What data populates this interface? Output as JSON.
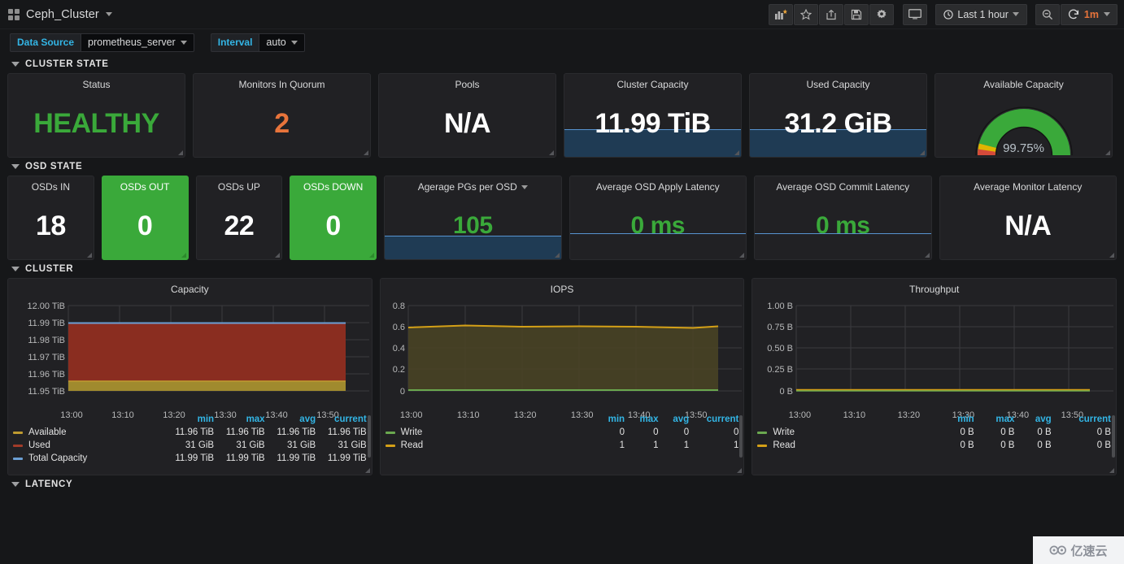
{
  "nav": {
    "dashboard_title": "Ceph_Cluster",
    "icons": [
      "dashboard-grid-icon",
      "add-panel-icon",
      "star-icon",
      "share-icon",
      "save-icon",
      "settings-icon",
      "tv-mode-icon",
      "zoom-out-icon",
      "refresh-icon"
    ],
    "time_range": "Last 1 hour",
    "refresh_interval": "1m",
    "refresh_color": "#e8743b"
  },
  "submenu": {
    "datasource_label": "Data Source",
    "datasource_value": "prometheus_server",
    "interval_label": "Interval",
    "interval_value": "auto"
  },
  "rows": {
    "cluster_state": "CLUSTER STATE",
    "osd_state": "OSD STATE",
    "cluster": "CLUSTER",
    "latency": "LATENCY"
  },
  "cluster_state": [
    {
      "title": "Status",
      "value": "HEALTHY",
      "color": "#3aa93a",
      "style": "plain"
    },
    {
      "title": "Monitors In Quorum",
      "value": "2",
      "color": "#e8743b",
      "style": "plain"
    },
    {
      "title": "Pools",
      "value": "N/A",
      "color": "#ffffff",
      "style": "plain"
    },
    {
      "title": "Cluster Capacity",
      "value": "11.99 TiB",
      "color": "#ffffff",
      "style": "sparkline"
    },
    {
      "title": "Used Capacity",
      "value": "31.2 GiB",
      "color": "#ffffff",
      "style": "sparkline"
    },
    {
      "title": "Available Capacity",
      "value": "99.75%",
      "color": "#3aa93a",
      "style": "gauge"
    }
  ],
  "osd_state": [
    {
      "title": "OSDs IN",
      "value": "18",
      "color": "#ffffff",
      "style": "plain",
      "bg": "none"
    },
    {
      "title": "OSDs OUT",
      "value": "0",
      "color": "#ffffff",
      "style": "plain",
      "bg": "green"
    },
    {
      "title": "OSDs UP",
      "value": "22",
      "color": "#ffffff",
      "style": "plain",
      "bg": "none"
    },
    {
      "title": "OSDs DOWN",
      "value": "0",
      "color": "#ffffff",
      "style": "plain",
      "bg": "green"
    },
    {
      "title": "Agerage PGs per OSD",
      "value": "105",
      "color": "#3aa93a",
      "style": "sparkline-dd",
      "bg": "none"
    },
    {
      "title": "Average OSD Apply Latency",
      "value": "0 ms",
      "color": "#3aa93a",
      "style": "line",
      "bg": "none"
    },
    {
      "title": "Average OSD Commit Latency",
      "value": "0 ms",
      "color": "#3aa93a",
      "style": "line",
      "bg": "none"
    },
    {
      "title": "Average Monitor Latency",
      "value": "N/A",
      "color": "#ffffff",
      "style": "plain",
      "bg": "none"
    }
  ],
  "chart_data": [
    {
      "type": "area",
      "title": "Capacity",
      "xlabel": "",
      "ylabel": "",
      "x": [
        "13:00",
        "13:10",
        "13:20",
        "13:30",
        "13:40",
        "13:50"
      ],
      "yticks": [
        "11.95 TiB",
        "11.96 TiB",
        "11.97 TiB",
        "11.98 TiB",
        "11.99 TiB",
        "12.00 TiB"
      ],
      "ylim": [
        11.95,
        12.0
      ],
      "grid": true,
      "legend_position": "bottom-table",
      "legend_columns": [
        "min",
        "max",
        "avg",
        "current"
      ],
      "series": [
        {
          "name": "Available",
          "color": "#bf9b30",
          "values": [
            11.96,
            11.96,
            11.96,
            11.96,
            11.96,
            11.96
          ],
          "min": "11.96 TiB",
          "max": "11.96 TiB",
          "avg": "11.96 TiB",
          "current": "11.96 TiB"
        },
        {
          "name": "Used",
          "color": "#a23b29",
          "values": [
            0.031,
            0.031,
            0.031,
            0.031,
            0.031,
            0.031
          ],
          "min": "31 GiB",
          "max": "31 GiB",
          "avg": "31 GiB",
          "current": "31 GiB"
        },
        {
          "name": "Total Capacity",
          "color": "#6b9fd4",
          "values": [
            11.99,
            11.99,
            11.99,
            11.99,
            11.99,
            11.99
          ],
          "min": "11.99 TiB",
          "max": "11.99 TiB",
          "avg": "11.99 TiB",
          "current": "11.99 TiB"
        }
      ]
    },
    {
      "type": "area",
      "title": "IOPS",
      "xlabel": "",
      "ylabel": "",
      "x": [
        "13:00",
        "13:10",
        "13:20",
        "13:30",
        "13:40",
        "13:50"
      ],
      "yticks": [
        "0",
        "0.2",
        "0.4",
        "0.6",
        "0.8"
      ],
      "ylim": [
        0,
        0.8
      ],
      "grid": true,
      "legend_position": "bottom-table",
      "legend_columns": [
        "min",
        "max",
        "avg",
        "current"
      ],
      "series": [
        {
          "name": "Write",
          "color": "#6aa84f",
          "values": [
            0,
            0,
            0,
            0,
            0,
            0
          ],
          "min": "0",
          "max": "0",
          "avg": "0",
          "current": "0"
        },
        {
          "name": "Read",
          "color": "#d4a017",
          "values": [
            0.6,
            0.62,
            0.61,
            0.61,
            0.6,
            0.61
          ],
          "min": "1",
          "max": "1",
          "avg": "1",
          "current": "1"
        }
      ]
    },
    {
      "type": "area",
      "title": "Throughput",
      "xlabel": "",
      "ylabel": "",
      "x": [
        "13:00",
        "13:10",
        "13:20",
        "13:30",
        "13:40",
        "13:50"
      ],
      "yticks": [
        "0 B",
        "0.25 B",
        "0.50 B",
        "0.75 B",
        "1.00 B"
      ],
      "ylim": [
        0,
        1
      ],
      "grid": true,
      "legend_position": "bottom-table",
      "legend_columns": [
        "min",
        "max",
        "avg",
        "current"
      ],
      "series": [
        {
          "name": "Write",
          "color": "#6aa84f",
          "values": [
            0,
            0,
            0,
            0,
            0,
            0
          ],
          "min": "0 B",
          "max": "0 B",
          "avg": "0 B",
          "current": "0 B"
        },
        {
          "name": "Read",
          "color": "#d4a017",
          "values": [
            0,
            0,
            0,
            0,
            0,
            0
          ],
          "min": "0 B",
          "max": "0 B",
          "avg": "0 B",
          "current": "0 B"
        }
      ]
    }
  ],
  "watermark": {
    "text": "亿速云"
  }
}
